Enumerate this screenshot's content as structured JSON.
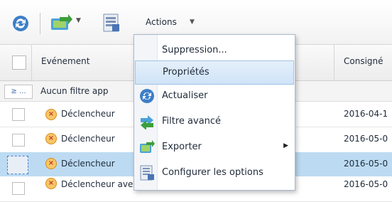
{
  "toolbar": {
    "refresh_icon": "refresh-icon",
    "export_icon": "export-icon",
    "options_icon": "configure-options-icon",
    "actions_label": "Actions",
    "caret": "▼"
  },
  "grid": {
    "header": {
      "event": "Evénement",
      "consigne": "Consigné"
    },
    "filter": {
      "icon_label": "≥ ...",
      "text": "Aucun filtre app"
    },
    "rows": [
      {
        "text": "Déclencheur",
        "date": "2016-04-1",
        "selected": false
      },
      {
        "text": "Déclencheur",
        "date": "2016-05-0",
        "selected": false
      },
      {
        "text": "Déclencheur",
        "date": "2016-05-0",
        "selected": true
      },
      {
        "text": "Déclencheur avec commande",
        "date": "2016-05-0",
        "selected": false
      }
    ]
  },
  "context_menu": {
    "items": [
      {
        "label": "Suppression...",
        "icon": ""
      },
      {
        "label": "Propriétés",
        "icon": "",
        "hover": true
      },
      {
        "label": "Actualiser",
        "icon": "refresh-icon"
      },
      {
        "label": "Filtre avancé",
        "icon": "advanced-filter-icon"
      },
      {
        "label": "Exporter",
        "icon": "export-icon",
        "submenu": true
      },
      {
        "label": "Configurer les options",
        "icon": "configure-options-icon"
      }
    ]
  },
  "colors": {
    "selected_row": "#bcdbf2",
    "menu_hover": "#cfe3f7",
    "warning_icon": "#f7c765"
  }
}
